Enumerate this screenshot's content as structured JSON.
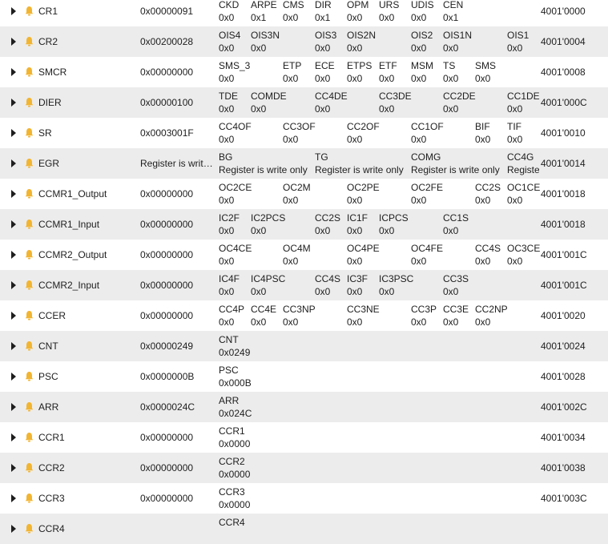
{
  "accent_icon_color": "#f2b532",
  "caret_icon": "chevron-right-icon",
  "register_icon": "bell-icon",
  "registers": [
    {
      "name": "CR1",
      "value": "0x00000091",
      "address": "4001'0000",
      "fields": [
        {
          "n": "CKD",
          "v": "0x0",
          "c": 0
        },
        {
          "n": "ARPE",
          "v": "0x1",
          "c": 1
        },
        {
          "n": "CMS",
          "v": "0x0",
          "c": 2
        },
        {
          "n": "DIR",
          "v": "0x1",
          "c": 3
        },
        {
          "n": "OPM",
          "v": "0x0",
          "c": 4
        },
        {
          "n": "URS",
          "v": "0x0",
          "c": 5
        },
        {
          "n": "UDIS",
          "v": "0x0",
          "c": 6
        },
        {
          "n": "CEN",
          "v": "0x1",
          "c": 7
        }
      ]
    },
    {
      "name": "CR2",
      "value": "0x00200028",
      "address": "4001'0004",
      "fields": [
        {
          "n": "OIS4",
          "v": "0x0",
          "c": 0
        },
        {
          "n": "OIS3N",
          "v": "0x0",
          "c": 1
        },
        {
          "n": "OIS3",
          "v": "0x0",
          "c": 3
        },
        {
          "n": "OIS2N",
          "v": "0x0",
          "c": 4
        },
        {
          "n": "OIS2",
          "v": "0x0",
          "c": 6
        },
        {
          "n": "OIS1N",
          "v": "0x0",
          "c": 7
        },
        {
          "n": "OIS1",
          "v": "0x0",
          "c": 9
        }
      ]
    },
    {
      "name": "SMCR",
      "value": "0x00000000",
      "address": "4001'0008",
      "fields": [
        {
          "n": "SMS_3",
          "v": "0x0",
          "c": 0
        },
        {
          "n": "ETP",
          "v": "0x0",
          "c": 2
        },
        {
          "n": "ECE",
          "v": "0x0",
          "c": 3
        },
        {
          "n": "ETPS",
          "v": "0x0",
          "c": 4
        },
        {
          "n": "ETF",
          "v": "0x0",
          "c": 5
        },
        {
          "n": "MSM",
          "v": "0x0",
          "c": 6
        },
        {
          "n": "TS",
          "v": "0x0",
          "c": 7
        },
        {
          "n": "SMS",
          "v": "0x0",
          "c": 8
        }
      ]
    },
    {
      "name": "DIER",
      "value": "0x00000100",
      "address": "4001'000C",
      "fields": [
        {
          "n": "TDE",
          "v": "0x0",
          "c": 0
        },
        {
          "n": "COMDE",
          "v": "0x0",
          "c": 1
        },
        {
          "n": "CC4DE",
          "v": "0x0",
          "c": 3
        },
        {
          "n": "CC3DE",
          "v": "0x0",
          "c": 5
        },
        {
          "n": "CC2DE",
          "v": "0x0",
          "c": 7
        },
        {
          "n": "CC1DE",
          "v": "0x0",
          "c": 9
        }
      ]
    },
    {
      "name": "SR",
      "value": "0x0003001F",
      "address": "4001'0010",
      "fields": [
        {
          "n": "CC4OF",
          "v": "0x0",
          "c": 0
        },
        {
          "n": "CC3OF",
          "v": "0x0",
          "c": 2
        },
        {
          "n": "CC2OF",
          "v": "0x0",
          "c": 4
        },
        {
          "n": "CC1OF",
          "v": "0x0",
          "c": 6
        },
        {
          "n": "BIF",
          "v": "0x0",
          "c": 8
        },
        {
          "n": "TIF",
          "v": "0x0",
          "c": 9
        }
      ]
    },
    {
      "name": "EGR",
      "value": "Register is write only",
      "address": "4001'0014",
      "fields": [
        {
          "n": "BG",
          "v": "Register is write only",
          "c": 0
        },
        {
          "n": "TG",
          "v": "Register is write only",
          "c": 3
        },
        {
          "n": "COMG",
          "v": "Register is write only",
          "c": 6
        },
        {
          "n": "CC4G",
          "v": "Register is write only",
          "c": 9,
          "clip": 1
        }
      ]
    },
    {
      "name": "CCMR1_Output",
      "value": "0x00000000",
      "address": "4001'0018",
      "fields": [
        {
          "n": "OC2CE",
          "v": "0x0",
          "c": 0
        },
        {
          "n": "OC2M",
          "v": "0x0",
          "c": 2
        },
        {
          "n": "OC2PE",
          "v": "0x0",
          "c": 4
        },
        {
          "n": "OC2FE",
          "v": "0x0",
          "c": 6
        },
        {
          "n": "CC2S",
          "v": "0x0",
          "c": 8
        },
        {
          "n": "OC1CE",
          "v": "0x0",
          "c": 9
        }
      ]
    },
    {
      "name": "CCMR1_Input",
      "value": "0x00000000",
      "address": "4001'0018",
      "fields": [
        {
          "n": "IC2F",
          "v": "0x0",
          "c": 0
        },
        {
          "n": "IC2PCS",
          "v": "0x0",
          "c": 1
        },
        {
          "n": "CC2S",
          "v": "0x0",
          "c": 3
        },
        {
          "n": "IC1F",
          "v": "0x0",
          "c": 4
        },
        {
          "n": "ICPCS",
          "v": "0x0",
          "c": 5
        },
        {
          "n": "CC1S",
          "v": "0x0",
          "c": 7
        }
      ]
    },
    {
      "name": "CCMR2_Output",
      "value": "0x00000000",
      "address": "4001'001C",
      "fields": [
        {
          "n": "OC4CE",
          "v": "0x0",
          "c": 0
        },
        {
          "n": "OC4M",
          "v": "0x0",
          "c": 2
        },
        {
          "n": "OC4PE",
          "v": "0x0",
          "c": 4
        },
        {
          "n": "OC4FE",
          "v": "0x0",
          "c": 6
        },
        {
          "n": "CC4S",
          "v": "0x0",
          "c": 8
        },
        {
          "n": "OC3CE",
          "v": "0x0",
          "c": 9
        }
      ]
    },
    {
      "name": "CCMR2_Input",
      "value": "0x00000000",
      "address": "4001'001C",
      "fields": [
        {
          "n": "IC4F",
          "v": "0x0",
          "c": 0
        },
        {
          "n": "IC4PSC",
          "v": "0x0",
          "c": 1
        },
        {
          "n": "CC4S",
          "v": "0x0",
          "c": 3
        },
        {
          "n": "IC3F",
          "v": "0x0",
          "c": 4
        },
        {
          "n": "IC3PSC",
          "v": "0x0",
          "c": 5
        },
        {
          "n": "CC3S",
          "v": "0x0",
          "c": 7
        }
      ]
    },
    {
      "name": "CCER",
      "value": "0x00000000",
      "address": "4001'0020",
      "fields": [
        {
          "n": "CC4P",
          "v": "0x0",
          "c": 0
        },
        {
          "n": "CC4E",
          "v": "0x0",
          "c": 1
        },
        {
          "n": "CC3NP",
          "v": "0x0",
          "c": 2
        },
        {
          "n": "CC3NE",
          "v": "0x0",
          "c": 4
        },
        {
          "n": "CC3P",
          "v": "0x0",
          "c": 6
        },
        {
          "n": "CC3E",
          "v": "0x0",
          "c": 7
        },
        {
          "n": "CC2NP",
          "v": "0x0",
          "c": 8
        }
      ]
    },
    {
      "name": "CNT",
      "value": "0x00000249",
      "address": "4001'0024",
      "fields": [
        {
          "n": "CNT",
          "v": "0x0249",
          "c": 0
        }
      ]
    },
    {
      "name": "PSC",
      "value": "0x0000000B",
      "address": "4001'0028",
      "fields": [
        {
          "n": "PSC",
          "v": "0x000B",
          "c": 0
        }
      ]
    },
    {
      "name": "ARR",
      "value": "0x0000024C",
      "address": "4001'002C",
      "fields": [
        {
          "n": "ARR",
          "v": "0x024C",
          "c": 0
        }
      ]
    },
    {
      "name": "CCR1",
      "value": "0x00000000",
      "address": "4001'0034",
      "fields": [
        {
          "n": "CCR1",
          "v": "0x0000",
          "c": 0
        }
      ]
    },
    {
      "name": "CCR2",
      "value": "0x00000000",
      "address": "4001'0038",
      "fields": [
        {
          "n": "CCR2",
          "v": "0x0000",
          "c": 0
        }
      ]
    },
    {
      "name": "CCR3",
      "value": "0x00000000",
      "address": "4001'003C",
      "fields": [
        {
          "n": "CCR3",
          "v": "0x0000",
          "c": 0
        }
      ]
    },
    {
      "name": "CCR4",
      "value": "",
      "address": "",
      "fields": [
        {
          "n": "CCR4",
          "v": "",
          "c": 0
        }
      ]
    }
  ]
}
